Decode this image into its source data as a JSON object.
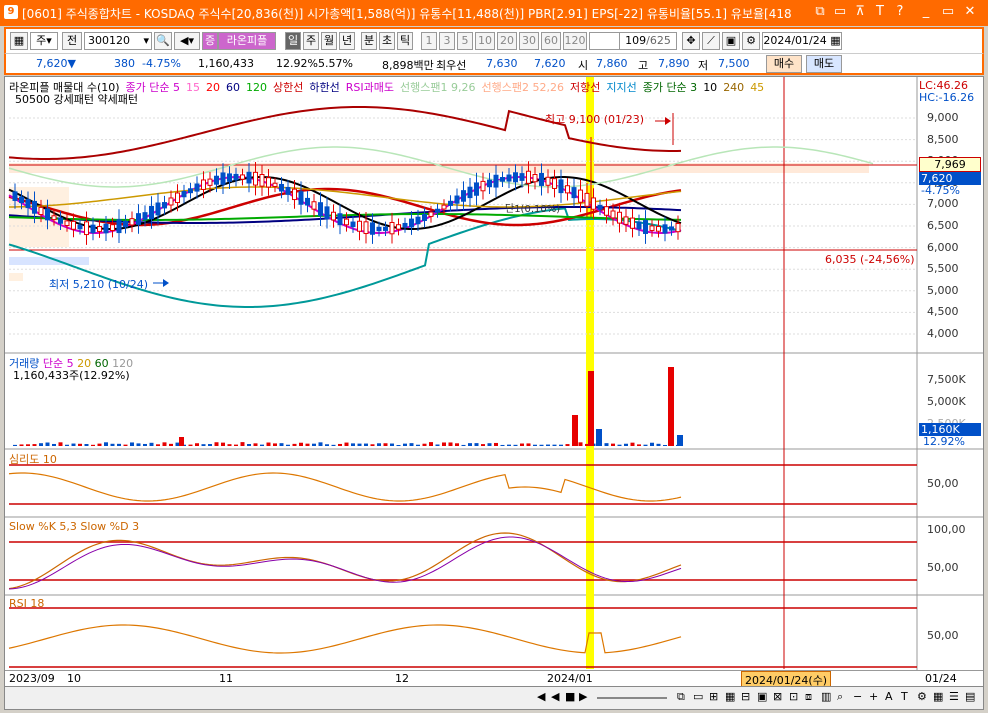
{
  "window": {
    "title": "[0601] 주식종합차트 - KOSDAQ 주식수[20,836(천)] 시가총액[1,588(억)] 유통수[11,488(천)] PBR[2.91] EPS[-22] 유통비율[55.1] 유보율[418",
    "app_number": "9",
    "buttons": [
      "⧉",
      "▭",
      "⊼",
      "T",
      "?",
      "_",
      "▭",
      "✕"
    ]
  },
  "toolbar": {
    "period_type": "주",
    "all_label": "전",
    "stock_code": "300120",
    "stock_name": "라온피플",
    "market_badge": "증",
    "periods": [
      "일",
      "주",
      "월",
      "년",
      "분",
      "초",
      "틱"
    ],
    "intervals": [
      "1",
      "3",
      "5",
      "10",
      "20",
      "30",
      "60",
      "120"
    ],
    "count": "109",
    "count_total": "/625",
    "date": "2024/01/24"
  },
  "price_bar": {
    "price": "7,620",
    "change": "380",
    "change_pct": "-4.75%",
    "volume": "1,160,433",
    "turnover_pct": "12.92%",
    "ratio": "5.57%",
    "amount": "8,898백만",
    "best_ask_label": "최우선",
    "best_ask": "7,630",
    "best_bid": "7,620",
    "open_label": "시",
    "open": "7,860",
    "high_label": "고",
    "high": "7,890",
    "low_label": "저",
    "low": "7,500",
    "buy_label": "매수",
    "sell_label": "매도"
  },
  "legends": {
    "main_line1": [
      {
        "text": "라온피플 매물대 수(10)",
        "color": "#000000"
      },
      {
        "text": "종가 단순 5",
        "color": "#cc00cc"
      },
      {
        "text": "15",
        "color": "#ff66cc"
      },
      {
        "text": "20",
        "color": "#ff0000"
      },
      {
        "text": "60",
        "color": "#000080"
      },
      {
        "text": "120",
        "color": "#00aa00"
      },
      {
        "text": "상한선",
        "color": "#cc0000"
      },
      {
        "text": "하한선",
        "color": "#000080"
      },
      {
        "text": "RSI과매도",
        "color": "#cc00cc"
      },
      {
        "text": "선행스팬1 9,26",
        "color": "#99cc99"
      },
      {
        "text": "선행스팬2 52,26",
        "color": "#ffaa88"
      },
      {
        "text": "저항선",
        "color": "#cc0000"
      },
      {
        "text": "지지선",
        "color": "#0088cc"
      },
      {
        "text": "종가 단순 3",
        "color": "#006600"
      },
      {
        "text": "10",
        "color": "#000000"
      },
      {
        "text": "240",
        "color": "#996600"
      },
      {
        "text": "45",
        "color": "#cc9900"
      }
    ],
    "main_line2": "50500 강세패턴  약세패턴",
    "lc": "LC:46.26",
    "hc": "HC:-16.26",
    "volume": [
      "거래량",
      "단순 5",
      "20",
      "60",
      "120"
    ],
    "volume_value": "1,160,433주(12.92%)",
    "psych": "심리도 10",
    "stoch": "Slow %K 5,3  Slow %D 3",
    "rsi": "RSI 18"
  },
  "annotations": {
    "high": "최고 9,100 (01/23)",
    "low": "최저 5,210 (10/24)",
    "line_label": "6,035 (-24,56%)",
    "pattern": "단1(0.10%)"
  },
  "y_axis_main": [
    "9,000",
    "8,500",
    "8,000",
    "7,500",
    "7,000",
    "6,500",
    "6,000",
    "5,500",
    "5,000",
    "4,500",
    "4,000"
  ],
  "price_tags": {
    "resist": "7,969",
    "current": "7,620",
    "pct": "-4.75%"
  },
  "y_axis_volume": [
    "7,500K",
    "5,000K",
    "2,500K"
  ],
  "volume_tags": {
    "value": "1,160K",
    "pct": "12.92%"
  },
  "y_axis_psych": [
    "50,00"
  ],
  "y_axis_stoch": [
    "100,00",
    "50,00"
  ],
  "y_axis_rsi": [
    "50,00"
  ],
  "x_axis": [
    "2023/09",
    "10",
    "11",
    "12",
    "2024/01"
  ],
  "x_axis_right": "01/24",
  "cursor_date": "2024/01/24(수)",
  "colors": {
    "accent": "#ff6a00",
    "up": "#e60000",
    "down": "#0050c8",
    "highlight": "#ffff00"
  }
}
